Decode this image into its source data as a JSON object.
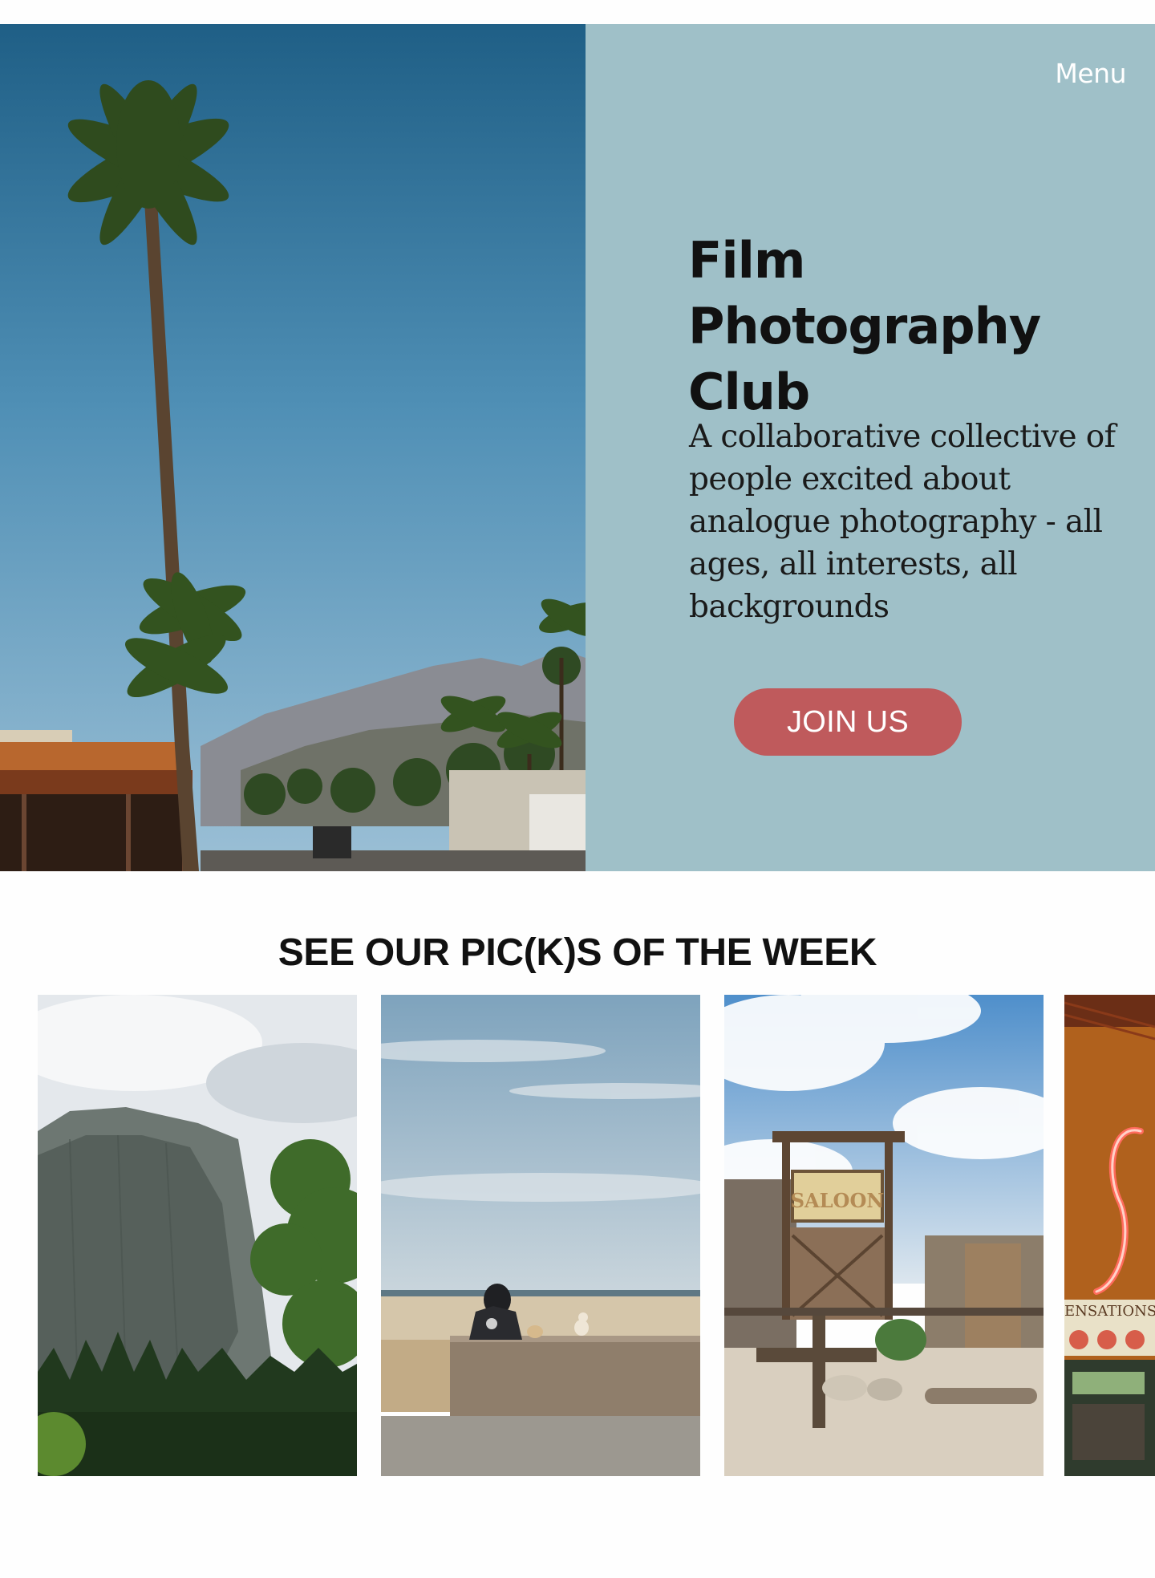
{
  "header": {
    "menu_label": "Menu"
  },
  "hero": {
    "title_lines": [
      "Film",
      "Photography",
      "Club"
    ],
    "tagline": "A collaborative collective of people excited about analogue photography - all ages, all interests, all backgrounds",
    "cta_label": "JOIN US",
    "panel_color": "#9fc0c8",
    "cta_color": "#bf5a5c"
  },
  "picks": {
    "heading": "SEE OUR PIC(K)S OF THE WEEK",
    "photos": [
      {
        "name": "photo-granite-cliff"
      },
      {
        "name": "photo-beach-wall"
      },
      {
        "name": "photo-saloon"
      },
      {
        "name": "photo-neon-sign"
      }
    ],
    "saloon_sign": "SALOON",
    "neon_sign_partial": "ENSATIONS"
  }
}
